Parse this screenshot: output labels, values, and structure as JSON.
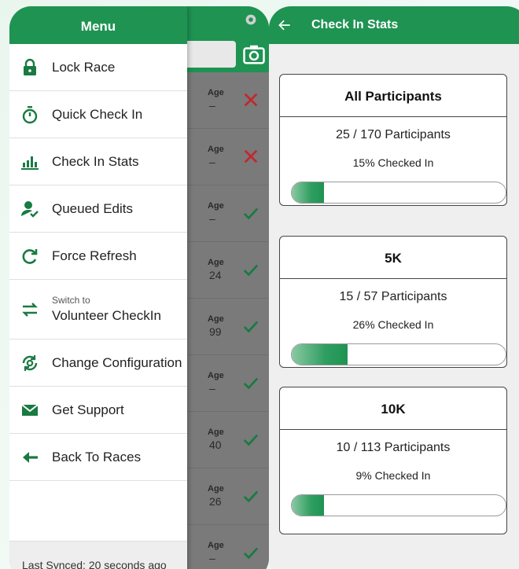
{
  "menu": {
    "title": "Menu",
    "items": [
      {
        "label": "Lock Race",
        "icon": "lock-icon"
      },
      {
        "label": "Quick Check In",
        "icon": "stopwatch-icon"
      },
      {
        "label": "Check In Stats",
        "icon": "bar-chart-icon"
      },
      {
        "label": "Queued Edits",
        "icon": "user-check-icon"
      },
      {
        "label": "Force Refresh",
        "icon": "refresh-icon"
      },
      {
        "label": "Volunteer CheckIn",
        "sublabel": "Switch to",
        "icon": "swap-arrows-icon"
      },
      {
        "label": "Change Configuration",
        "icon": "config-cycle-icon"
      },
      {
        "label": "Get Support",
        "icon": "mail-icon"
      },
      {
        "label": "Back To Races",
        "icon": "arrow-left-icon"
      }
    ],
    "footer": "Last Synced: 20 seconds ago"
  },
  "background_list": {
    "rows": [
      {
        "age_label": "Age",
        "age": "–",
        "status": "x"
      },
      {
        "age_label": "Age",
        "age": "–",
        "status": "x"
      },
      {
        "age_label": "Age",
        "age": "–",
        "status": "check"
      },
      {
        "age_label": "Age",
        "age": "24",
        "status": "check"
      },
      {
        "age_label": "Age",
        "age": "99",
        "status": "check"
      },
      {
        "age_label": "Age",
        "age": "–",
        "status": "check"
      },
      {
        "age_label": "Age",
        "age": "40",
        "status": "check"
      },
      {
        "age_label": "Age",
        "age": "26",
        "status": "check"
      },
      {
        "age_label": "Age",
        "age": "–",
        "status": "check"
      }
    ]
  },
  "stats": {
    "title": "Check In Stats",
    "cards": [
      {
        "title": "All Participants",
        "count": "25 / 170 Participants",
        "pct": "15% Checked In",
        "fraction": 0.15
      },
      {
        "title": "5K",
        "count": "15 / 57 Participants",
        "pct": "26% Checked In",
        "fraction": 0.26
      },
      {
        "title": "10K",
        "count": "10 / 113 Participants",
        "pct": "9% Checked In",
        "fraction": 0.09
      }
    ]
  },
  "colors": {
    "brand": "#1f9352",
    "error": "#c0282d",
    "check": "#1a7a42"
  }
}
